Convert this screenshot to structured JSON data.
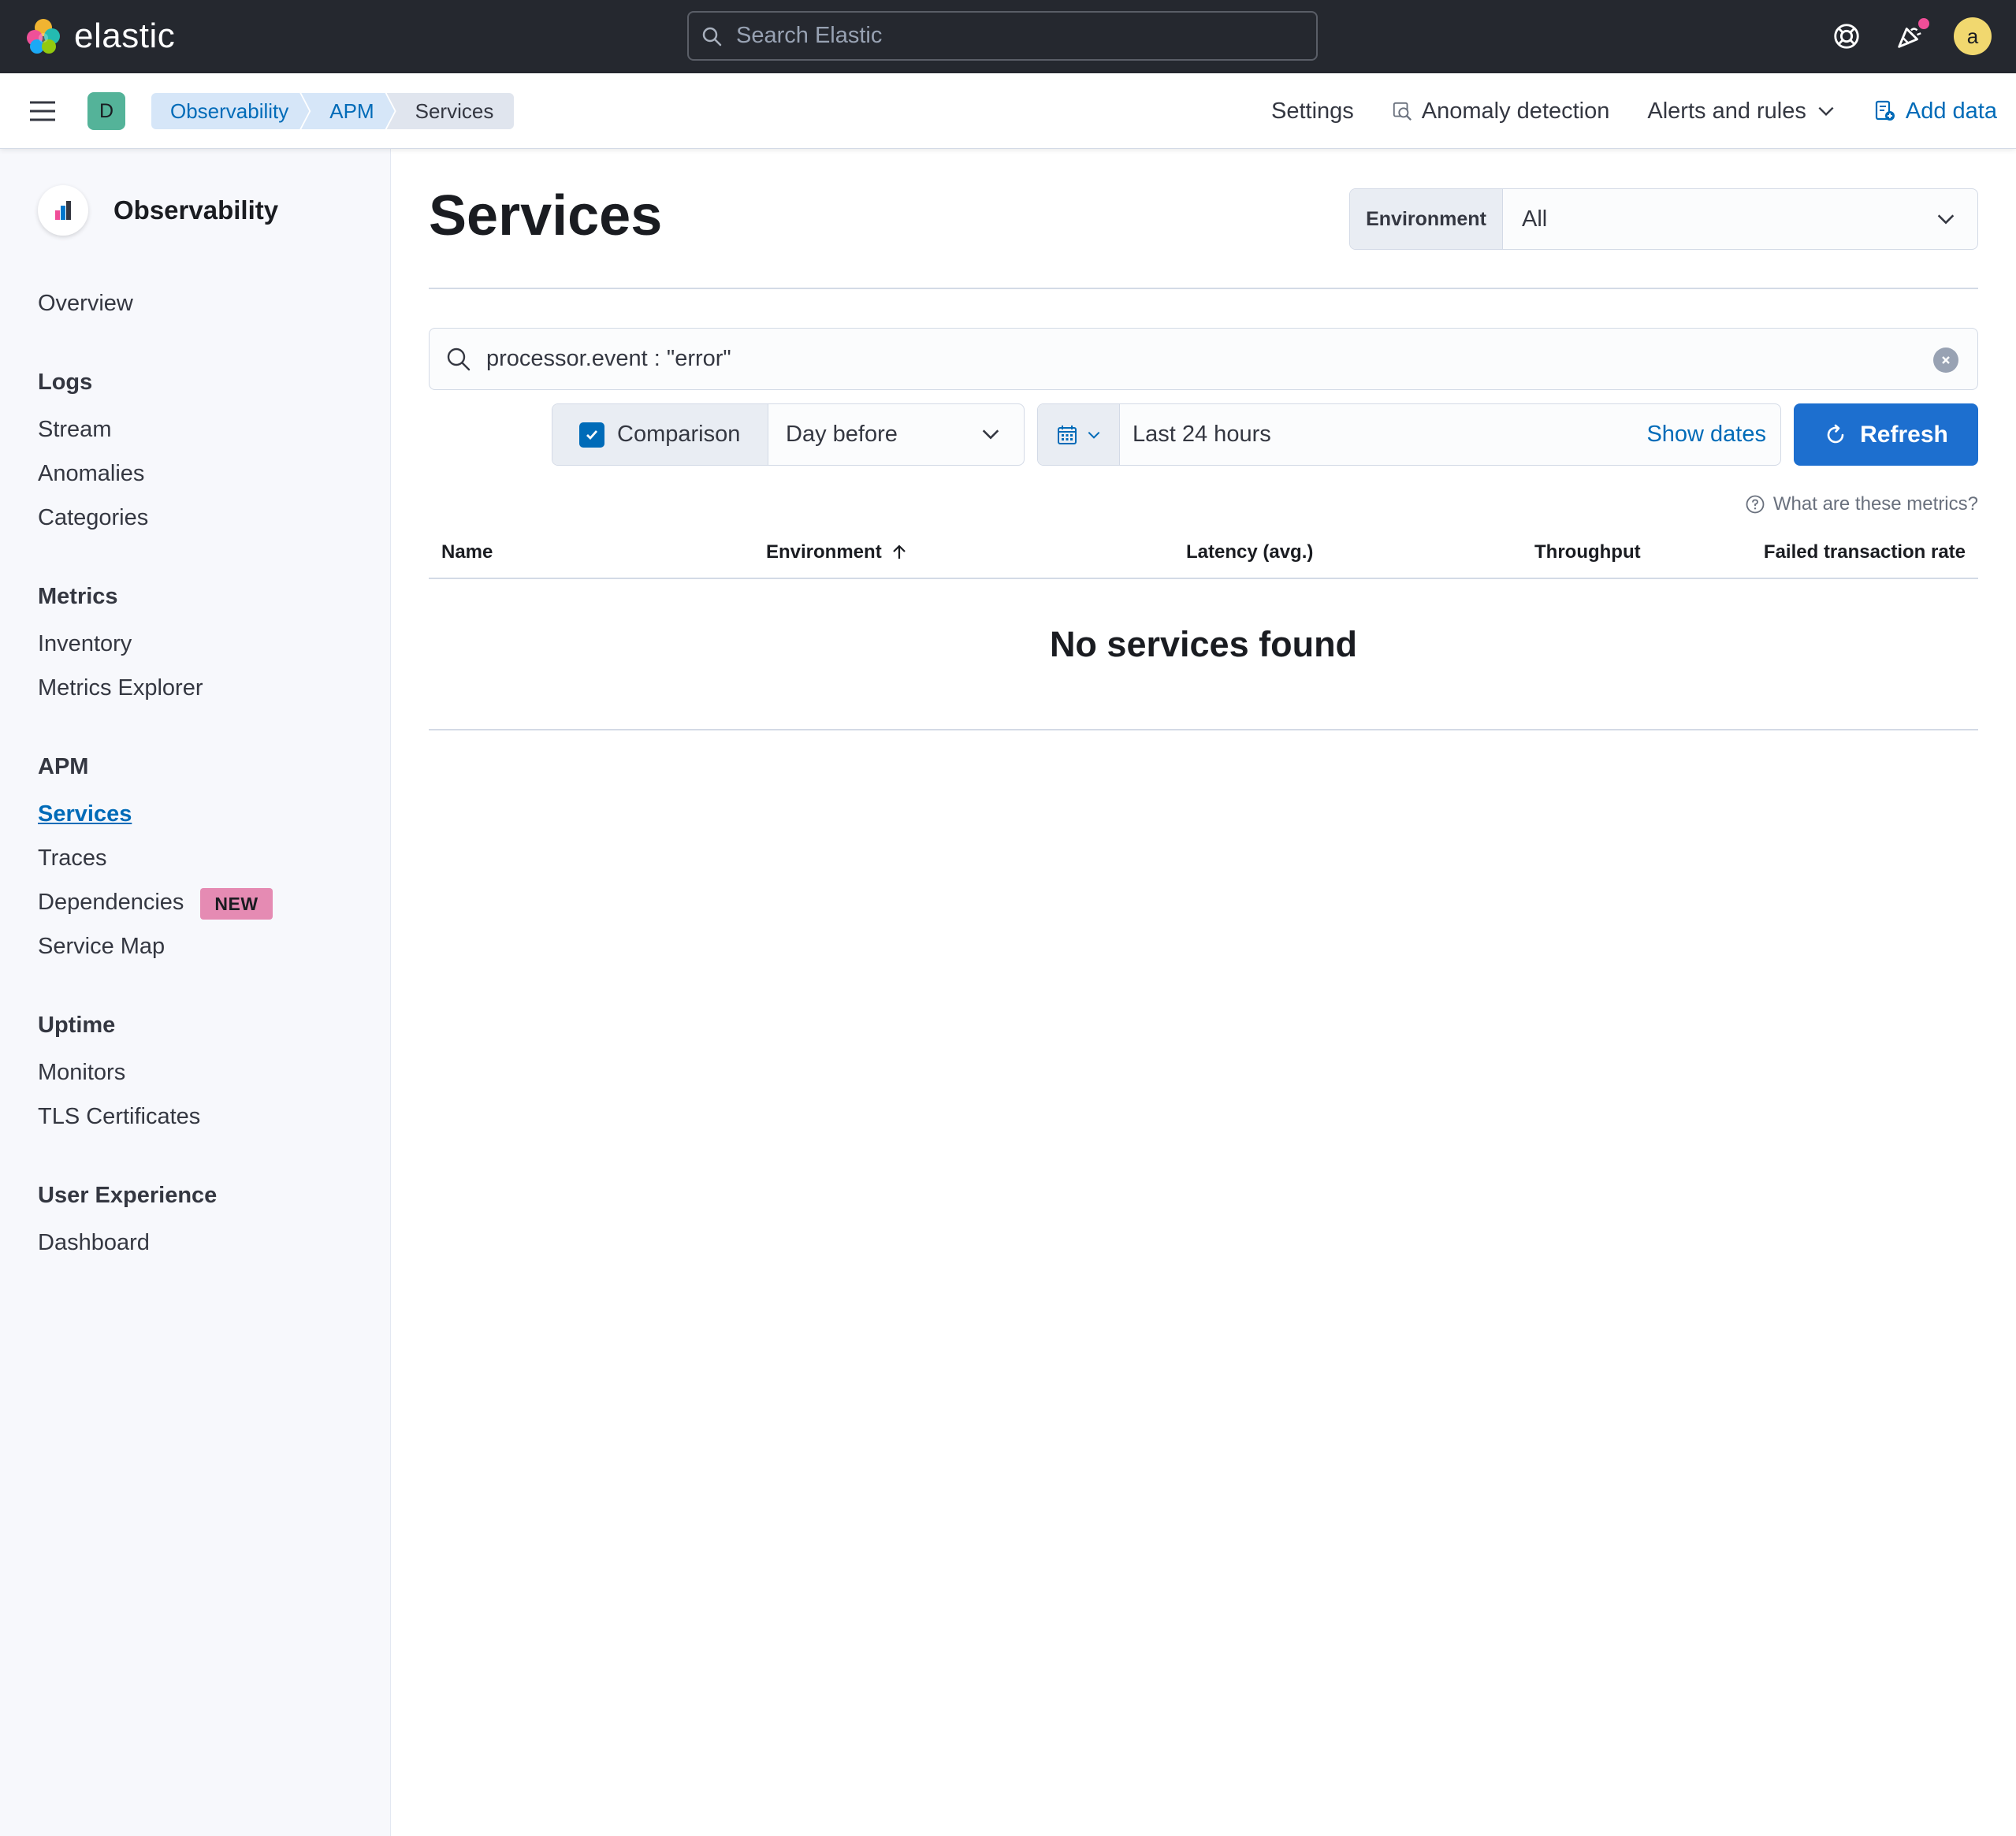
{
  "header": {
    "logo_text": "elastic",
    "search_placeholder": "Search Elastic",
    "avatar_initial": "a"
  },
  "subheader": {
    "space_initial": "D",
    "breadcrumbs": [
      "Observability",
      "APM",
      "Services"
    ],
    "links": {
      "settings": "Settings",
      "anomaly": "Anomaly detection",
      "alerts": "Alerts and rules",
      "add_data": "Add data"
    }
  },
  "sidebar": {
    "title": "Observability",
    "overview": "Overview",
    "groups": {
      "logs": "Logs",
      "metrics": "Metrics",
      "apm": "APM",
      "uptime": "Uptime",
      "ux": "User Experience"
    },
    "items": {
      "stream": "Stream",
      "anomalies": "Anomalies",
      "categories": "Categories",
      "inventory": "Inventory",
      "metrics_explorer": "Metrics Explorer",
      "services": "Services",
      "traces": "Traces",
      "dependencies": "Dependencies",
      "dependencies_badge": "NEW",
      "service_map": "Service Map",
      "monitors": "Monitors",
      "tls": "TLS Certificates",
      "dashboard": "Dashboard"
    }
  },
  "main": {
    "title": "Services",
    "environment": {
      "label": "Environment",
      "value": "All"
    },
    "query": "processor.event : \"error\"",
    "comparison": {
      "label": "Comparison",
      "checked": true,
      "value": "Day before"
    },
    "datepicker": {
      "range": "Last 24 hours",
      "show_dates": "Show dates"
    },
    "refresh": "Refresh",
    "metrics_help": "What are these metrics?",
    "table": {
      "columns": [
        "Name",
        "Environment",
        "Latency (avg.)",
        "Throughput",
        "Failed transaction rate"
      ],
      "empty": "No services found"
    }
  },
  "colors": {
    "header_bg": "#25282f",
    "accent": "#006bb8",
    "primary_button": "#1d6fcf",
    "badge_new": "#e58bb3",
    "space_avatar": "#54b399",
    "user_avatar": "#f1d86f"
  }
}
